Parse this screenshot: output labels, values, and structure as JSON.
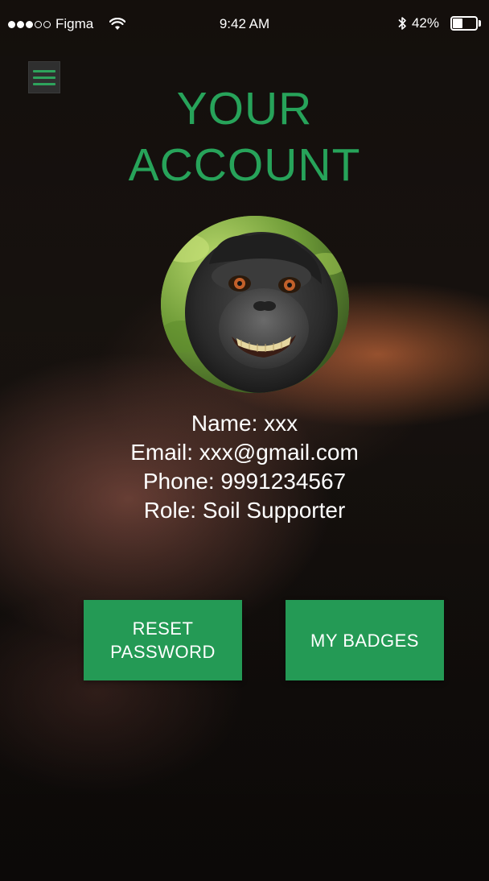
{
  "status_bar": {
    "carrier": "Figma",
    "time": "9:42 AM",
    "battery_text": "42%",
    "battery_level": 0.42,
    "signal_bars_filled": 3,
    "signal_bars_total": 5
  },
  "header": {
    "title_line1": "YOUR",
    "title_line2": "ACCOUNT"
  },
  "profile": {
    "name": "Name: xxx",
    "email": "Email: xxx@gmail.com",
    "phone": "Phone: 9991234567",
    "role": "Role: Soil Supporter"
  },
  "actions": {
    "reset_password_label": "RESET\nPASSWORD",
    "my_badges_label": "MY BADGES"
  },
  "colors": {
    "accent": "#27a35a",
    "button": "#249a55",
    "menu_bg": "#2f2f2f"
  },
  "icons": {
    "menu": "hamburger-menu-icon",
    "wifi": "wifi-icon",
    "bluetooth": "bluetooth-icon",
    "battery": "battery-icon"
  }
}
